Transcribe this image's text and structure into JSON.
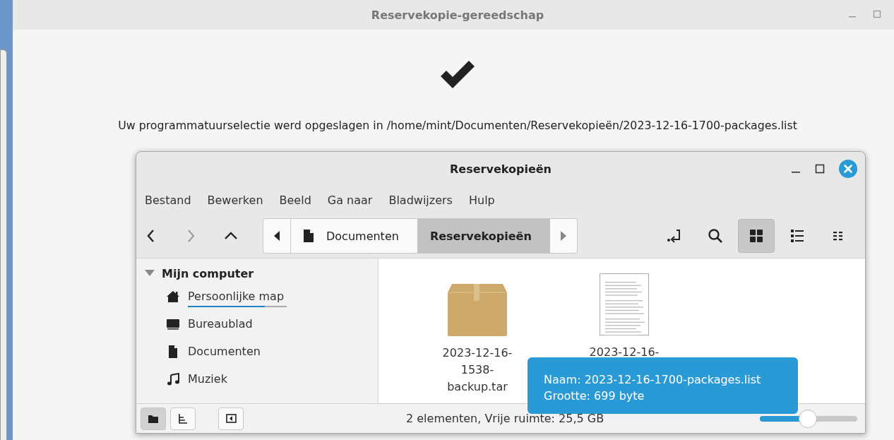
{
  "dialog": {
    "title": "Reservekopie-gereedschap",
    "message": "Uw programmatuurselectie werd opgeslagen in /home/mint/Documenten/Reservekopieën/2023-12-16-1700-packages.list"
  },
  "file_manager": {
    "title": "Reservekopieën",
    "menu": [
      "Bestand",
      "Bewerken",
      "Beeld",
      "Ga naar",
      "Bladwijzers",
      "Hulp"
    ],
    "nav_buttons": [
      {
        "kind": "back",
        "disabled": false
      },
      {
        "kind": "forward",
        "disabled": true
      },
      {
        "kind": "up",
        "disabled": false
      }
    ],
    "path": [
      {
        "label": "Documenten",
        "selected": false
      },
      {
        "label": "Reservekopieën",
        "selected": true
      }
    ],
    "view_buttons": [
      {
        "kind": "location",
        "selected": false
      },
      {
        "kind": "search",
        "selected": false
      },
      {
        "kind": "icons",
        "selected": true
      },
      {
        "kind": "list",
        "selected": false
      },
      {
        "kind": "compact",
        "selected": false
      }
    ],
    "sidebar": [
      {
        "label": "Mijn computer",
        "expanded": true,
        "children": [
          {
            "label": "Persoonlijke map",
            "kind": "home",
            "level": 0.78
          },
          {
            "label": "Bureaublad",
            "kind": "desktop"
          },
          {
            "label": "Documenten",
            "kind": "document"
          },
          {
            "label": "Muziek",
            "kind": "music"
          }
        ]
      }
    ],
    "files": [
      {
        "name": "2023-12-16-1538-backup.tar",
        "kind": "archive"
      },
      {
        "name": "2023-12-16-",
        "kind": "text"
      }
    ],
    "tooltip": [
      "Naam: 2023-12-16-1700-packages.list",
      "Grootte: 699 byte"
    ],
    "bottom_buttons": [
      {
        "kind": "places",
        "selected": true
      },
      {
        "kind": "tree",
        "selected": false
      },
      {
        "kind": "sidebar",
        "selected": false
      }
    ],
    "status": "2 elementen, Vrije ruimte: 25,5 GB",
    "zoom": {
      "level": 0.49
    }
  }
}
